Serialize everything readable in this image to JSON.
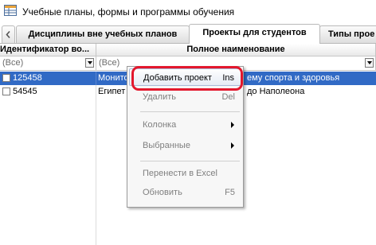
{
  "window": {
    "title": "Учебные планы, формы и программы обучения",
    "icon": "grid-table-icon"
  },
  "tabs": [
    {
      "label": "Дисциплины вне учебных планов",
      "active": false
    },
    {
      "label": "Проекты для студентов",
      "active": true
    },
    {
      "label": "Типы прое",
      "active": false
    }
  ],
  "grid": {
    "columns": [
      {
        "label": "Идентификатор во...",
        "filter": "(Все)"
      },
      {
        "label": "Полное наименование",
        "filter": "(Все)"
      }
    ],
    "rows": [
      {
        "id": "125458",
        "name_start": "Монито",
        "name_end": "ему спорта и здоровья",
        "selected": true
      },
      {
        "id": "54545",
        "name_start": "Египет",
        "name_end": "до Наполеона",
        "selected": false
      }
    ]
  },
  "context_menu": {
    "items": [
      {
        "label": "Добавить проект",
        "shortcut": "Ins",
        "highlighted": true,
        "enabled": true
      },
      {
        "label": "Удалить",
        "shortcut": "Del",
        "enabled": false
      },
      {
        "label": "Колонка",
        "submenu": true,
        "enabled": false
      },
      {
        "label": "Выбранные",
        "submenu": true,
        "enabled": false
      },
      {
        "label": "Перенести в Excel",
        "enabled": false
      },
      {
        "label": "Обновить",
        "shortcut": "F5",
        "enabled": false
      }
    ]
  },
  "colors": {
    "selection": "#316ac5",
    "annotation": "#e3182d"
  }
}
